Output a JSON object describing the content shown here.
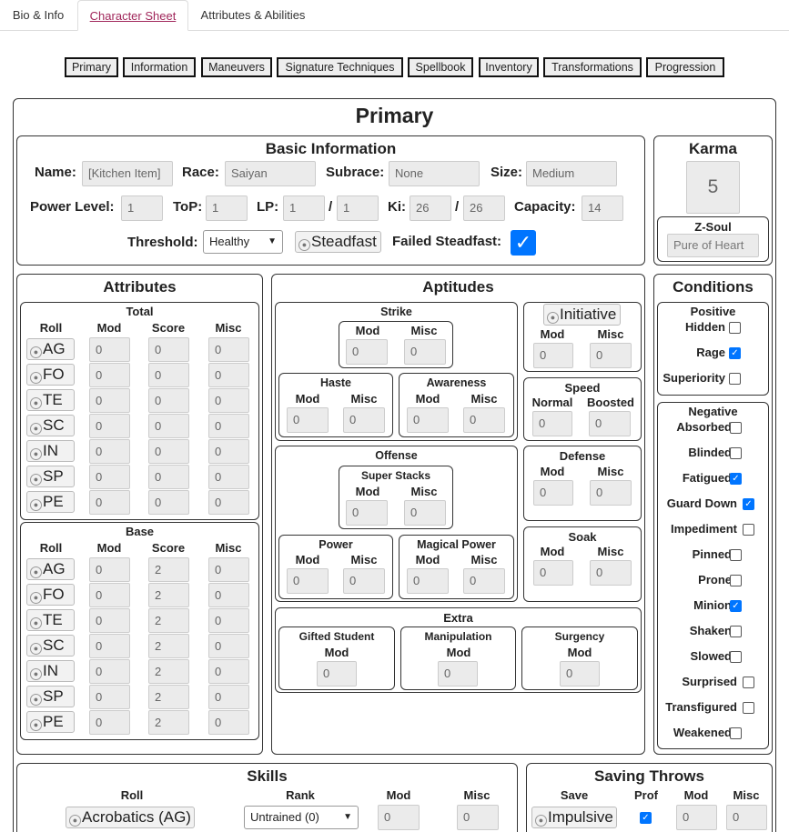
{
  "tabs": [
    "Bio & Info",
    "Character Sheet",
    "Attributes & Abilities"
  ],
  "subtabs": [
    "Primary",
    "Information",
    "Maneuvers",
    "Signature Techniques",
    "Spellbook",
    "Inventory",
    "Transformations",
    "Progression"
  ],
  "title": "Primary",
  "basic": {
    "heading": "Basic Information",
    "name_label": "Name:",
    "name_value": "[Kitchen Item]",
    "race_label": "Race:",
    "race_value": "Saiyan",
    "subrace_label": "Subrace:",
    "subrace_value": "None",
    "size_label": "Size:",
    "size_value": "Medium",
    "pl_label": "Power Level:",
    "pl_value": "1",
    "top_label": "ToP:",
    "top_value": "1",
    "lp_label": "LP:",
    "lp_value": "1",
    "lp_max": "1",
    "slash": "/",
    "ki_label": "Ki:",
    "ki_value": "26",
    "ki_max": "26",
    "cap_label": "Capacity:",
    "cap_value": "14",
    "threshold_label": "Threshold:",
    "threshold_value": "Healthy",
    "steadfast_button": "Steadfast",
    "failed_label": "Failed Steadfast:"
  },
  "karma": {
    "heading": "Karma",
    "value": "5",
    "zsoul_heading": "Z-Soul",
    "zsoul_placeholder": "Pure of Heart"
  },
  "attributes": {
    "heading": "Attributes",
    "total": "Total",
    "base": "Base",
    "cols": [
      "Roll",
      "Mod",
      "Score",
      "Misc"
    ],
    "names": [
      "AG",
      "FO",
      "TE",
      "SC",
      "IN",
      "SP",
      "PE"
    ],
    "total_rows": [
      [
        "0",
        "0",
        "0"
      ],
      [
        "0",
        "0",
        "0"
      ],
      [
        "0",
        "0",
        "0"
      ],
      [
        "0",
        "0",
        "0"
      ],
      [
        "0",
        "0",
        "0"
      ],
      [
        "0",
        "0",
        "0"
      ],
      [
        "0",
        "0",
        "0"
      ]
    ],
    "base_rows": [
      [
        "0",
        "2",
        "0"
      ],
      [
        "0",
        "2",
        "0"
      ],
      [
        "0",
        "2",
        "0"
      ],
      [
        "0",
        "2",
        "0"
      ],
      [
        "0",
        "2",
        "0"
      ],
      [
        "0",
        "2",
        "0"
      ],
      [
        "0",
        "2",
        "0"
      ]
    ]
  },
  "aptitudes": {
    "heading": "Aptitudes",
    "mod": "Mod",
    "misc": "Misc",
    "strike": "Strike",
    "haste": "Haste",
    "awareness": "Awareness",
    "initiative": "Initiative",
    "speed": "Speed",
    "normal": "Normal",
    "boosted": "Boosted",
    "offense": "Offense",
    "super_stacks": "Super Stacks",
    "power": "Power",
    "magical_power": "Magical Power",
    "defense": "Defense",
    "soak": "Soak",
    "extra": "Extra",
    "gifted": "Gifted Student",
    "manipulation": "Manipulation",
    "surgency": "Surgency",
    "zero": "0"
  },
  "conditions": {
    "heading": "Conditions",
    "positive": "Positive",
    "negative": "Negative",
    "pos_items": [
      {
        "label": "Hidden",
        "checked": false
      },
      {
        "label": "Rage",
        "checked": true
      },
      {
        "label": "Superiority",
        "checked": false
      }
    ],
    "neg_items": [
      {
        "label": "Absorbed",
        "checked": false
      },
      {
        "label": "Blinded",
        "checked": false
      },
      {
        "label": "Fatigued",
        "checked": true
      },
      {
        "label": "Guard Down",
        "checked": true
      },
      {
        "label": "Impediment",
        "checked": false
      },
      {
        "label": "Pinned",
        "checked": false
      },
      {
        "label": "Prone",
        "checked": false
      },
      {
        "label": "Minion",
        "checked": true
      },
      {
        "label": "Shaken",
        "checked": false
      },
      {
        "label": "Slowed",
        "checked": false
      },
      {
        "label": "Surprised",
        "checked": false
      },
      {
        "label": "Transfigured",
        "checked": false
      },
      {
        "label": "Weakened",
        "checked": false
      }
    ]
  },
  "skills": {
    "heading": "Skills",
    "cols": [
      "Roll",
      "Rank",
      "Mod",
      "Misc"
    ],
    "first_skill": "Acrobatics (AG)",
    "rank_value": "Untrained (0)",
    "mod": "0",
    "misc": "0"
  },
  "saves": {
    "heading": "Saving Throws",
    "cols": [
      "Save",
      "Prof",
      "Mod",
      "Misc"
    ],
    "first_save": "Impulsive",
    "mod": "0",
    "misc": "0"
  }
}
